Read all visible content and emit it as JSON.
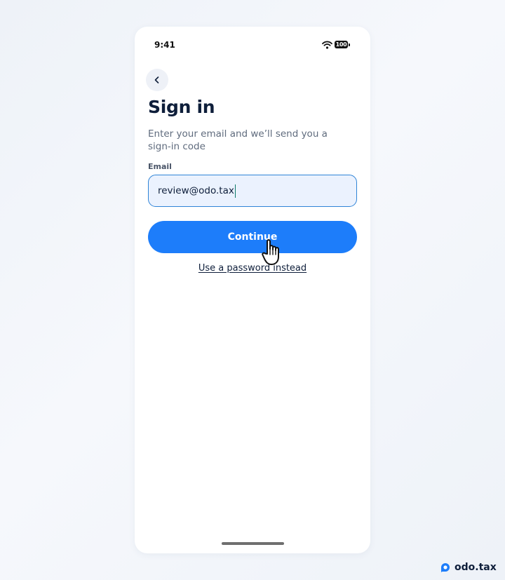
{
  "status_bar": {
    "time": "9:41",
    "battery_level": "100"
  },
  "signin": {
    "title": "Sign in",
    "subtitle": "Enter your email and we’ll send you a sign-in code",
    "email_label": "Email",
    "email_value": "review@odo.tax",
    "continue_label": "Continue",
    "password_link": "Use a password instead"
  },
  "brand": {
    "name": "odo.tax"
  },
  "colors": {
    "primary": "#1d7dfa",
    "title": "#0e1e3a",
    "input_border": "#2f84d7",
    "input_background": "#ebf2fe"
  },
  "icons": {
    "back": "chevron-left-icon",
    "wifi": "wifi-icon",
    "battery": "battery-icon",
    "cursor": "hand-cursor-icon",
    "logo": "odo-logo-icon"
  }
}
